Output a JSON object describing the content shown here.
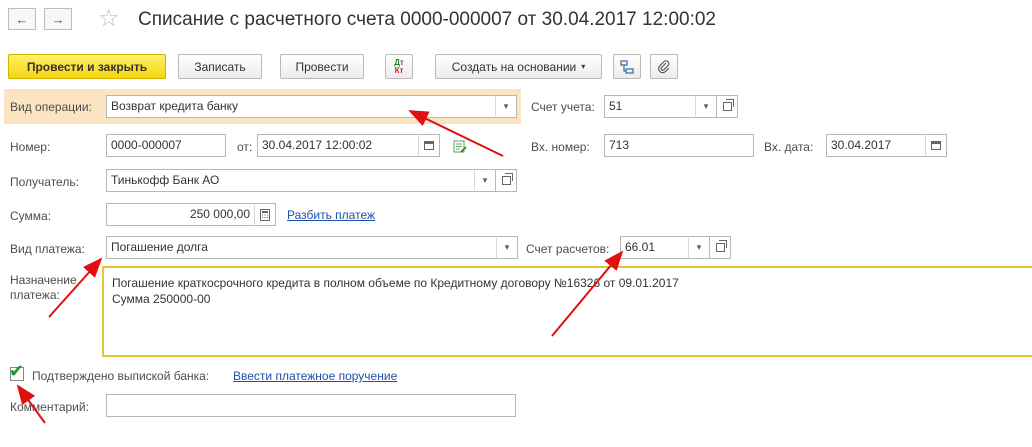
{
  "window": {
    "title": "Списание с расчетного счета 0000-000007 от 30.04.2017 12:00:02",
    "back_icon": "←",
    "forward_icon": "→",
    "star_icon": "☆"
  },
  "toolbar": {
    "post_close": "Провести и закрыть",
    "save": "Записать",
    "post": "Провести",
    "dtkt_top": "Дт",
    "dtkt_bottom": "Кт",
    "create_based": "Создать на основании",
    "structure_icon": "structure-icon",
    "attach_icon": "paperclip-icon"
  },
  "form": {
    "operation_type_label": "Вид операции:",
    "operation_type_value": "Возврат кредита банку",
    "account_label": "Счет учета:",
    "account_value": "51",
    "number_label": "Номер:",
    "number_value": "0000-000007",
    "date_label": "от:",
    "date_value": "30.04.2017 12:00:02",
    "in_number_label": "Вх. номер:",
    "in_number_value": "713",
    "in_date_label": "Вх. дата:",
    "in_date_value": "30.04.2017",
    "recipient_label": "Получатель:",
    "recipient_value": "Тинькофф Банк АО",
    "amount_label": "Сумма:",
    "amount_value": "250 000,00",
    "split_link": "Разбить платеж",
    "payment_type_label": "Вид платежа:",
    "payment_type_value": "Погашение долга",
    "settlement_account_label": "Счет расчетов:",
    "settlement_account_value": "66.01",
    "purpose_label_line1": "Назначение",
    "purpose_label_line2": "платежа:",
    "purpose_line1": "Погашение краткосрочного кредита в полном объеме  по Кредитному договору №16326 от 09.01.2017",
    "purpose_line2": "Сумма 250000-00",
    "confirmed_label": "Подтверждено выпиской банка:",
    "confirmed_checked": true,
    "enter_order_link": "Ввести платежное поручение",
    "comment_label": "Комментарий:",
    "comment_value": ""
  },
  "colors": {
    "accent_yellow": "#f5d50f",
    "highlight": "#fbe4c2",
    "link": "#1f4fa8",
    "annotation_arrow": "#e01010",
    "check_green": "#1a9a2c"
  }
}
